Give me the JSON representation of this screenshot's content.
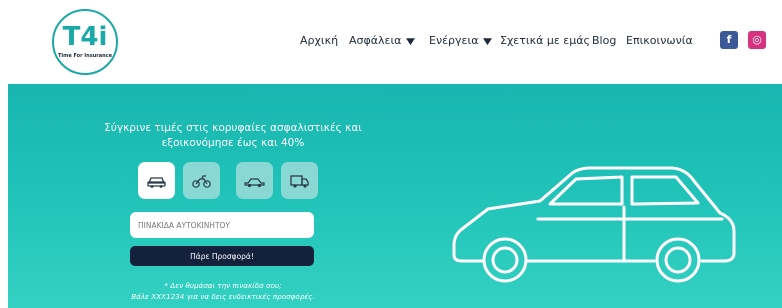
{
  "logo": {
    "mark": "T4i",
    "tagline": "Time For Insurance",
    "color": "#1aa9a7"
  },
  "nav": {
    "items": [
      {
        "label": "Αρχική",
        "dropdown": false
      },
      {
        "label": "Ασφάλεια",
        "dropdown": true
      },
      {
        "label": "Ενέργεια",
        "dropdown": true
      },
      {
        "label": "Σχετικά με εμάς",
        "dropdown": false
      },
      {
        "label": "Blog",
        "dropdown": false
      },
      {
        "label": "Επικοινωνία",
        "dropdown": false
      }
    ],
    "social": [
      {
        "icon": "facebook-icon",
        "glyph": "f",
        "color": "#3b5998"
      },
      {
        "icon": "instagram-icon",
        "glyph": "◎",
        "color": "#d6337e"
      }
    ]
  },
  "hero": {
    "headline_line1": "Σύγκρινε τιμές στις κορυφαίες ασφαλιστικές και",
    "headline_line2": "εξοικονόμησε έως και 40%",
    "vehicle_tabs": [
      {
        "icon": "car-icon",
        "active": true
      },
      {
        "icon": "motorcycle-icon",
        "active": false
      },
      {
        "icon": "sedan-icon",
        "active": false
      },
      {
        "icon": "truck-icon",
        "active": false
      }
    ],
    "plate_placeholder": "ΠΙΝΑΚΙΔΑ ΑΥΤΟΚΙΝΗΤΟΥ",
    "offer_button": "Πάρε Προσφορά!",
    "note_line1": "* Δεν θυμάσαι την πινακίδα σου;",
    "note_line2": "Βάλε ΧΧΧ1234 για να δεις ενδεικτικές προσφορές.",
    "accent": "#1ebfb6",
    "button_color": "#14213d"
  }
}
